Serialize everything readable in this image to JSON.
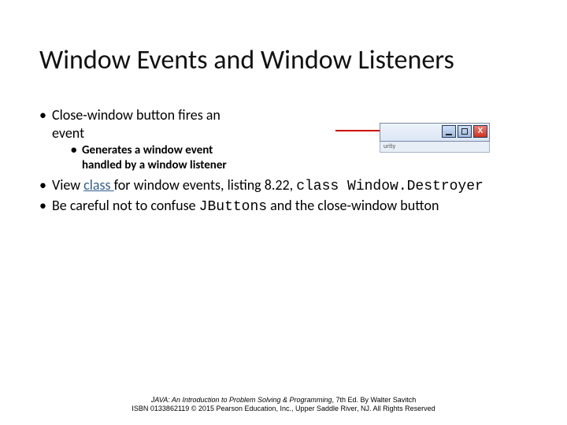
{
  "title": "Window Events and Window Listeners",
  "bullets": {
    "b1": "Close-window button fires an event",
    "b1_sub": "Generates a window event handled by a window listener",
    "b2_pre": "View ",
    "b2_link": "class ",
    "b2_mid": "for window events, listing 8.22, ",
    "b2_code": "class Window.Destroyer",
    "b3_pre": "Be careful not to confuse ",
    "b3_code": "JButtons",
    "b3_post": " and the close-window button"
  },
  "winimg": {
    "close_glyph": "X",
    "subbar_text": "urity"
  },
  "footer": {
    "line1_italic": "JAVA: An Introduction to Problem Solving & Programming",
    "line1_rest": ", 7th Ed. By Walter Savitch",
    "line2": "ISBN 0133862119 © 2015 Pearson Education, Inc., Upper Saddle River, NJ. All Rights Reserved"
  }
}
